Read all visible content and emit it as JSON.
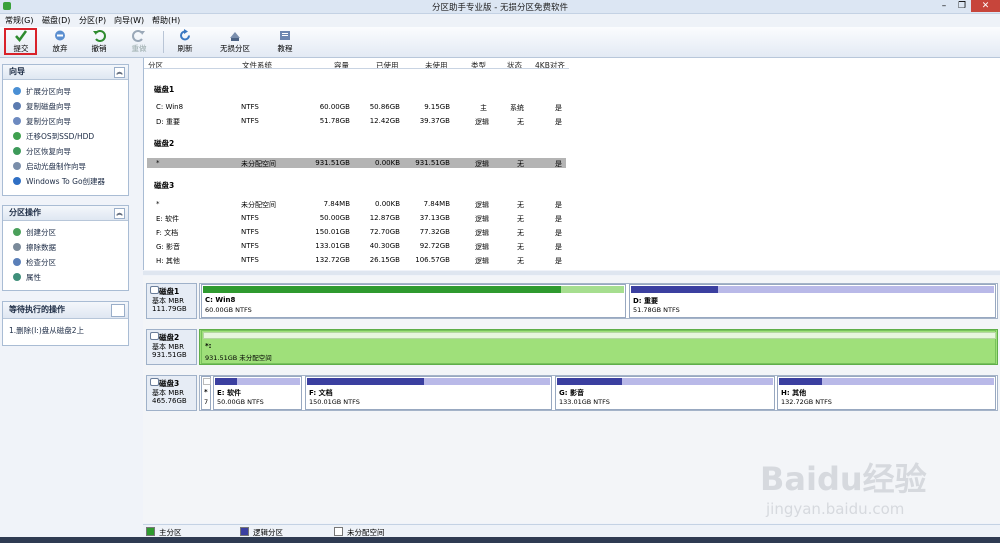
{
  "window": {
    "title": "分区助手专业版 - 无损分区免费软件",
    "controls": [
      "minimize-icon",
      "restore-icon",
      "close-icon"
    ]
  },
  "menu": [
    "常规(G)",
    "磁盘(D)",
    "分区(P)",
    "向导(W)",
    "帮助(H)"
  ],
  "toolbar": {
    "submit": "提交",
    "discard": "放弃",
    "undo": "撤销",
    "redo": "重做",
    "refresh": "刷新",
    "lossless": "无损分区",
    "tutorial": "教程"
  },
  "panels": {
    "wizard": {
      "title": "向导",
      "items": [
        "扩展分区向导",
        "复制磁盘向导",
        "复制分区向导",
        "迁移OS到SSD/HDD",
        "分区恢复向导",
        "启动光盘制作向导",
        "Windows To Go创建器"
      ]
    },
    "partition_ops": {
      "title": "分区操作",
      "items": [
        "创建分区",
        "擦除数据",
        "检查分区",
        "属性"
      ]
    },
    "pending": {
      "title": "等待执行的操作",
      "items": [
        "1.删除(I:)盘从磁盘2上"
      ]
    }
  },
  "columns": [
    "分区",
    "文件系统",
    "容量",
    "已使用",
    "未使用",
    "类型",
    "状态",
    "4KB对齐"
  ],
  "disks": [
    {
      "label": "磁盘1",
      "rows": [
        {
          "name": "C: Win8",
          "fs": "NTFS",
          "cap": "60.00GB",
          "used": "50.86GB",
          "free": "9.15GB",
          "type": "主",
          "status": "系统",
          "align": "是"
        },
        {
          "name": "D: 重要",
          "fs": "NTFS",
          "cap": "51.78GB",
          "used": "12.42GB",
          "free": "39.37GB",
          "type": "逻辑",
          "status": "无",
          "align": "是"
        }
      ]
    },
    {
      "label": "磁盘2",
      "rows": [
        {
          "name": "*",
          "fs": "未分配空间",
          "cap": "931.51GB",
          "used": "0.00KB",
          "free": "931.51GB",
          "type": "逻辑",
          "status": "无",
          "align": "是"
        }
      ]
    },
    {
      "label": "磁盘3",
      "rows": [
        {
          "name": "*",
          "fs": "未分配空间",
          "cap": "7.84MB",
          "used": "0.00KB",
          "free": "7.84MB",
          "type": "逻辑",
          "status": "无",
          "align": "是"
        },
        {
          "name": "E: 软件",
          "fs": "NTFS",
          "cap": "50.00GB",
          "used": "12.87GB",
          "free": "37.13GB",
          "type": "逻辑",
          "status": "无",
          "align": "是"
        },
        {
          "name": "F: 文档",
          "fs": "NTFS",
          "cap": "150.01GB",
          "used": "72.70GB",
          "free": "77.32GB",
          "type": "逻辑",
          "status": "无",
          "align": "是"
        },
        {
          "name": "G: 影音",
          "fs": "NTFS",
          "cap": "133.01GB",
          "used": "40.30GB",
          "free": "92.72GB",
          "type": "逻辑",
          "status": "无",
          "align": "是"
        },
        {
          "name": "H: 其他",
          "fs": "NTFS",
          "cap": "132.72GB",
          "used": "26.15GB",
          "free": "106.57GB",
          "type": "逻辑",
          "status": "无",
          "align": "是"
        }
      ]
    }
  ],
  "disk_map": [
    {
      "name": "磁盘1",
      "type": "基本 MBR",
      "size": "111.79GB",
      "parts": [
        {
          "label": "C: Win8",
          "info": "60.00GB NTFS",
          "kind": "primary",
          "used_fraction": 0.85
        },
        {
          "label": "D: 重要",
          "info": "51.78GB NTFS",
          "kind": "logical",
          "used_fraction": 0.24
        }
      ]
    },
    {
      "name": "磁盘2",
      "type": "基本 MBR",
      "size": "931.51GB",
      "parts": [
        {
          "label": "*:",
          "info": "931.51GB 未分配空间",
          "kind": "unallocated",
          "used_fraction": 0
        }
      ]
    },
    {
      "name": "磁盘3",
      "type": "基本 MBR",
      "size": "465.76GB",
      "parts": [
        {
          "label": "*",
          "info": "7",
          "kind": "unallocated",
          "used_fraction": 0
        },
        {
          "label": "E: 软件",
          "info": "50.00GB NTFS",
          "kind": "logical",
          "used_fraction": 0.26
        },
        {
          "label": "F: 文档",
          "info": "150.01GB NTFS",
          "kind": "logical",
          "used_fraction": 0.48
        },
        {
          "label": "G: 影音",
          "info": "133.01GB NTFS",
          "kind": "logical",
          "used_fraction": 0.3
        },
        {
          "label": "H: 其他",
          "info": "132.72GB NTFS",
          "kind": "logical",
          "used_fraction": 0.2
        }
      ]
    }
  ],
  "legend": {
    "primary": "主分区",
    "logical": "逻辑分区",
    "unallocated": "未分配空间"
  },
  "colors": {
    "primary": "#2f9a2f",
    "primary_light": "#a6de8f",
    "logical": "#3b3fa0",
    "logical_light": "#b9b9e8",
    "unallocated_bg": "#9fe07a",
    "highlight": "#d9222a"
  },
  "watermark": {
    "brand": "Baidu经验",
    "url": "jingyan.baidu.com"
  }
}
